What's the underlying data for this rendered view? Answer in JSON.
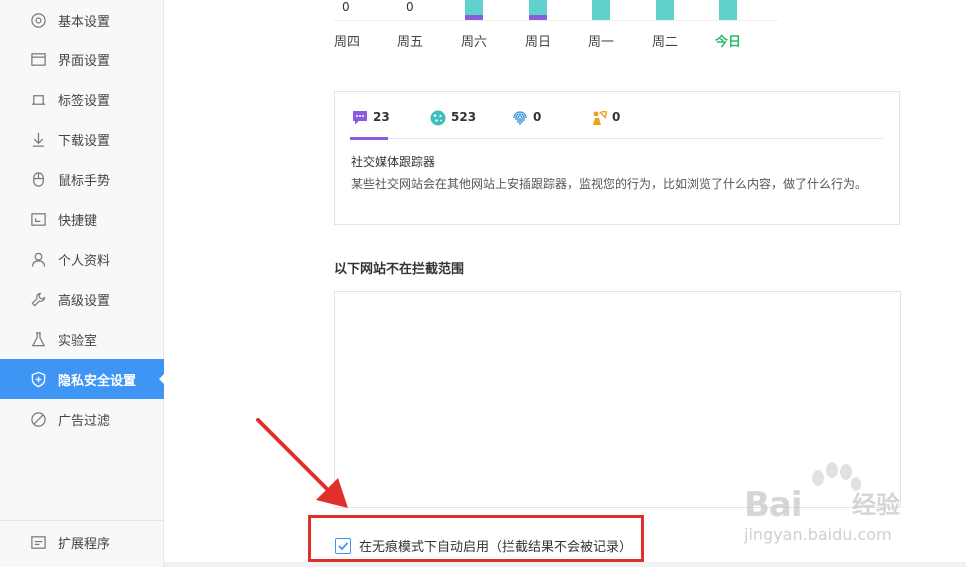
{
  "sidebar": {
    "items": [
      {
        "label": "基本设置",
        "icon": "gear-icon"
      },
      {
        "label": "界面设置",
        "icon": "window-icon"
      },
      {
        "label": "标签设置",
        "icon": "tab-icon"
      },
      {
        "label": "下载设置",
        "icon": "download-icon"
      },
      {
        "label": "鼠标手势",
        "icon": "mouse-icon"
      },
      {
        "label": "快捷键",
        "icon": "shortcut-icon"
      },
      {
        "label": "个人资料",
        "icon": "user-icon"
      },
      {
        "label": "高级设置",
        "icon": "wrench-icon"
      },
      {
        "label": "实验室",
        "icon": "flask-icon"
      },
      {
        "label": "隐私安全设置",
        "icon": "shield-icon",
        "active": true
      },
      {
        "label": "广告过滤",
        "icon": "block-icon"
      }
    ],
    "footer": {
      "label": "扩展程序",
      "icon": "extension-icon"
    }
  },
  "chart_data": {
    "type": "bar",
    "categories": [
      "周四",
      "周五",
      "周六",
      "周日",
      "周一",
      "周二",
      "今日"
    ],
    "visible_value_labels": [
      "0",
      "0"
    ],
    "highlight_category": "今日",
    "colors": {
      "primary": "#5fd3cb",
      "secondary": "#8a5de0",
      "today": "#2db96b"
    }
  },
  "tracker_card": {
    "tabs": [
      {
        "count": "23",
        "icon": "chat-bubble-icon"
      },
      {
        "count": "523",
        "icon": "cookie-icon"
      },
      {
        "count": "0",
        "icon": "fingerprint-icon"
      },
      {
        "count": "0",
        "icon": "miner-icon"
      }
    ],
    "title": "社交媒体跟踪器",
    "description": "某些社交网站会在其他网站上安插跟踪器，监视您的行为，比如浏览了什么内容，做了什么行为。"
  },
  "whitelist": {
    "title": "以下网站不在拦截范围"
  },
  "incognito_option": {
    "label": "在无痕模式下自动启用（拦截结果不会被记录）",
    "checked": true
  },
  "watermark": {
    "brand": "Bai",
    "brand_suffix": "经验",
    "url": "jingyan.baidu.com"
  },
  "colors": {
    "accent": "#3e95f3",
    "annotation": "#e0302b",
    "tab_active": "#8a5de0"
  }
}
